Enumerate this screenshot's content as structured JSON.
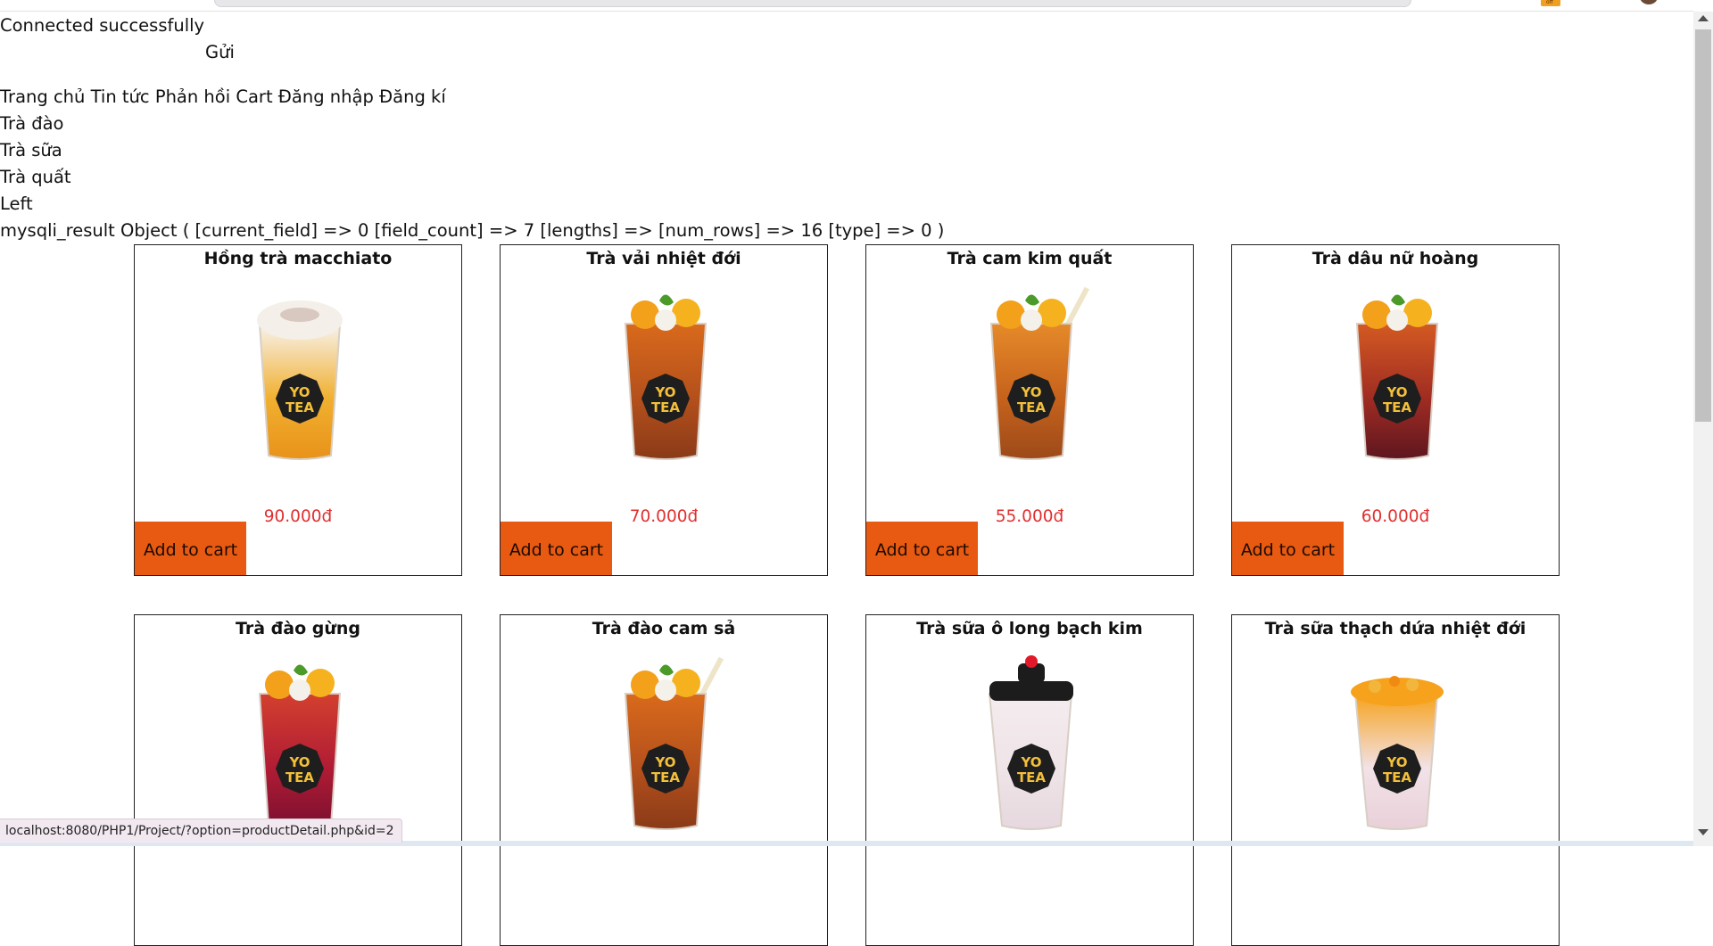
{
  "page": {
    "connection_message": "Connected successfully",
    "send_label": "Gửi",
    "nav": [
      "Trang chủ",
      "Tin tức",
      "Phản hồi",
      "Cart",
      "Đăng nhập",
      "Đăng kí"
    ],
    "categories": [
      "Trà đào",
      "Trà sữa",
      "Trà quất"
    ],
    "left_label": "Left",
    "debug_output": "mysqli_result Object ( [current_field] => 0 [field_count] => 7 [lengths] => [num_rows] => 16 [type] => 0 )"
  },
  "products": [
    {
      "name": "Hồng trà macchiato",
      "price": "90.000đ",
      "button": "Add to cart",
      "drink": "amber",
      "icon": "macchiato-cup-image"
    },
    {
      "name": "Trà vải nhiệt đới",
      "price": "70.000đ",
      "button": "Add to cart",
      "drink": "brown",
      "icon": "lychee-tea-image"
    },
    {
      "name": "Trà cam kim quất",
      "price": "55.000đ",
      "button": "Add to cart",
      "drink": "orange",
      "icon": "orange-kumquat-tea-image"
    },
    {
      "name": "Trà dâu nữ hoàng",
      "price": "60.000đ",
      "button": "Add to cart",
      "drink": "red",
      "icon": "strawberry-tea-image"
    },
    {
      "name": "Trà đào gừng",
      "price": "",
      "button": "",
      "drink": "berry",
      "icon": "peach-ginger-tea-image"
    },
    {
      "name": "Trà đào cam sả",
      "price": "",
      "button": "",
      "drink": "brown",
      "icon": "peach-orange-lemongrass-tea-image"
    },
    {
      "name": "Trà sữa ô long bạch kim",
      "price": "",
      "button": "",
      "drink": "milk",
      "icon": "oolong-milk-tea-image"
    },
    {
      "name": "Trà sữa thạch dứa nhiệt đới",
      "price": "",
      "button": "",
      "drink": "milk-jelly",
      "icon": "pineapple-jelly-milk-tea-image"
    }
  ],
  "status_bar": {
    "url": "localhost:8080/PHP1/Project/?option=productDetail.php&id=2"
  },
  "colors": {
    "accent": "#e85a12",
    "price": "#e03030"
  }
}
